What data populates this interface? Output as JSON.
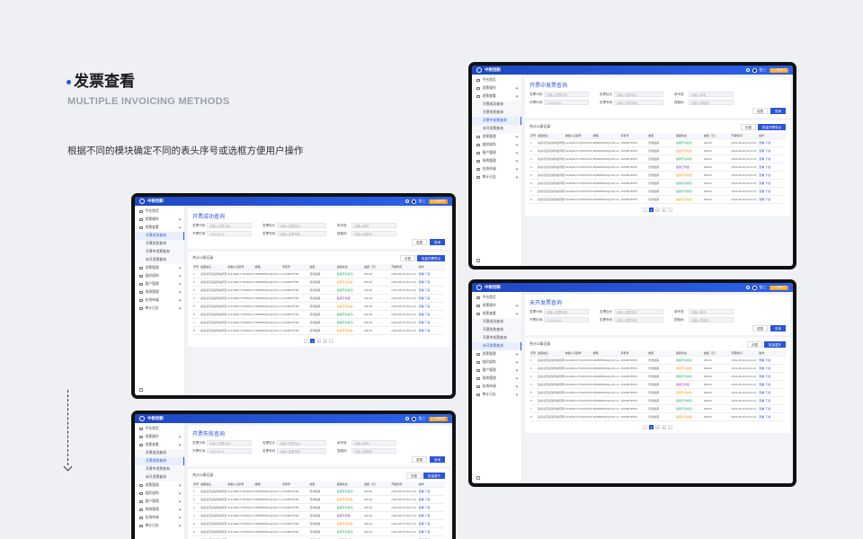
{
  "heading": {
    "title": "发票查看",
    "subtitle": "MULTIPLE INVOICING METHODS",
    "description": "根据不同的模块确定不同的表头序号或选框方便用户操作"
  },
  "app": {
    "brand": "中税创新",
    "user": "张三",
    "badge": "企业管理员",
    "nav": {
      "home": "平台首页",
      "invoice_ops": "发票操作",
      "invoice_query": "发票查看",
      "sub_success": "开票成功查询",
      "sub_fail": "开票失败查询",
      "sub_pending": "开票中发票查询",
      "sub_unopened": "未开发票查询",
      "manage": "发票管理",
      "org": "组织架构",
      "customer": "客户管理",
      "system": "系统管理",
      "audit": "在线申请",
      "stats": "审计日志"
    },
    "query": {
      "buyer": "发票抬头",
      "buyer_ph": "请输入发票抬头",
      "invoice_no": "发票号码",
      "invoice_no_ph": "请输入发票号码",
      "date": "开票时间",
      "date_start": "2019-08-01",
      "date_end": "2019-08-30",
      "code": "发票代码",
      "code_ph": "请输入发票代码",
      "amount": "金额",
      "amount_ph": "请输入金额",
      "order": "单号查",
      "order_ph": "请输入单号",
      "remark": "提取码",
      "remark_ph": "请输入提取码",
      "reset": "重置",
      "search": "查询"
    },
    "table": {
      "summary": "共计10条记录",
      "export": "批量开票导出",
      "export2": "批量重开",
      "settings": "设置",
      "cols": [
        "序号",
        "发票抬头",
        "纳税人识别号",
        "邮箱",
        "手机号",
        "类型",
        "发票状态",
        "金额（元）",
        "开票时间",
        "操作"
      ],
      "rows": [
        [
          "1",
          "某某北京某某科技有限公司",
          "91410821770035407A",
          "9838850961@163.com",
          "15338078786",
          "普通发票",
          "发票开具成功",
          "208.00",
          "2019-08-20 09:21:10",
          "查看 下载"
        ],
        [
          "2",
          "某某北京某某科技有限公司",
          "91410821770035407A",
          "9838850961@163.com",
          "15338078786",
          "普通发票",
          "发票开具失败",
          "208.00",
          "2019-08-20 09:21:10",
          "查看 下载"
        ],
        [
          "3",
          "某某北京某某科技有限公司",
          "91410821770035407A",
          "9838850961@163.com",
          "15338078786",
          "普通发票",
          "发票开具成功",
          "208.00",
          "2019-08-20 09:21:10",
          "查看 下载"
        ],
        [
          "4",
          "某某北京某某科技有限公司",
          "91410821770035407A",
          "9838850961@163.com",
          "15338078786",
          "普通发票",
          "发票已作废",
          "208.00",
          "2019-08-20 09:21:10",
          "查看 下载"
        ],
        [
          "5",
          "某某北京某某科技有限公司",
          "91410821770035407A",
          "9838850961@163.com",
          "15338078786",
          "普通发票",
          "发票开具失败",
          "208.00",
          "2019-08-20 09:21:10",
          "查看 下载"
        ],
        [
          "6",
          "某某北京某某科技有限公司",
          "91410821770035407A",
          "9838850961@163.com",
          "15338078786",
          "普通发票",
          "发票开具成功",
          "208.00",
          "2019-08-20 09:21:10",
          "查看 下载"
        ],
        [
          "7",
          "某某北京某某科技有限公司",
          "91410821770035407A",
          "9838850961@163.com",
          "15338078786",
          "普通发票",
          "发票开具成功",
          "208.00",
          "2019-08-20 09:21:10",
          "查看 下载"
        ],
        [
          "8",
          "某某北京某某科技有限公司",
          "91410821770035407A",
          "9838850961@163.com",
          "15338078786",
          "普通发票",
          "发票开具失败",
          "208.00",
          "2019-08-20 09:21:10",
          "查看 下载"
        ]
      ]
    },
    "screens": [
      {
        "title": "开票成功查询"
      },
      {
        "title": "开票失败查询"
      },
      {
        "title": "开票中发票查询"
      },
      {
        "title": "未开发票查询"
      }
    ]
  }
}
